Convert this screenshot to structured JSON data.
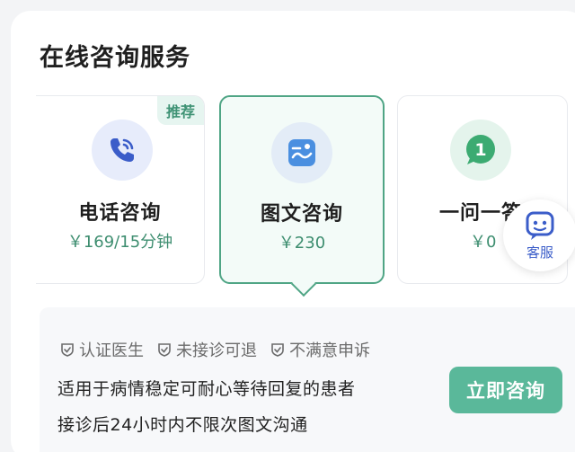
{
  "section_title": "在线咨询服务",
  "options": [
    {
      "name": "电话咨询",
      "price": "￥169/15分钟",
      "badge": "推荐",
      "icon": "phone-icon"
    },
    {
      "name": "图文咨询",
      "price": "￥230",
      "icon": "chat-image-icon",
      "selected": true
    },
    {
      "name": "一问一答",
      "price": "￥0",
      "icon": "one-badge-icon"
    }
  ],
  "float_service": {
    "label": "客服",
    "icon": "customer-service-icon"
  },
  "guarantees": [
    "认证医生",
    "未接诊可退",
    "不满意申诉"
  ],
  "description": {
    "line1": "适用于病情稳定可耐心等待回复的患者",
    "line2": "接诊后24小时内不限次图文沟通"
  },
  "consult_button": "立即咨询",
  "colors": {
    "accent": "#5ab89a",
    "price": "#3e8e70",
    "phone_icon": "#3b5dc9"
  }
}
